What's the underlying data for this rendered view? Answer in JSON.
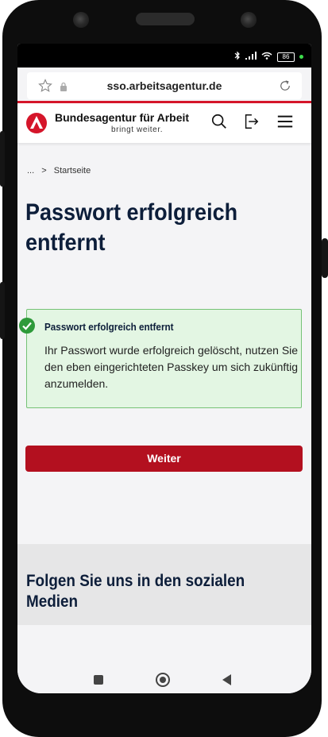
{
  "browser": {
    "url": "sso.arbeitsagentur.de",
    "battery": "86"
  },
  "header": {
    "brand": "Bundesagentur für Arbeit",
    "tagline": "bringt weiter."
  },
  "breadcrumb": {
    "ellipsis": "...",
    "separator": ">",
    "current": "Startseite"
  },
  "page": {
    "title_line1": "Passwort erfolgreich",
    "title_line2": "entfernt"
  },
  "alert": {
    "title": "Passwort erfolgreich entfernt",
    "body": "Ihr Passwort wurde erfolgreich gelöscht, nutzen Sie den eben eingerichteten Passkey um sich zukünftig anzumelden."
  },
  "actions": {
    "continue_label": "Weiter"
  },
  "social": {
    "title": "Folgen Sie uns in den sozialen Medien"
  },
  "colors": {
    "brand_red": "#d5152a",
    "button_red": "#b3101f",
    "success_green": "#2e9a3a",
    "title_navy": "#0d1e3a"
  }
}
